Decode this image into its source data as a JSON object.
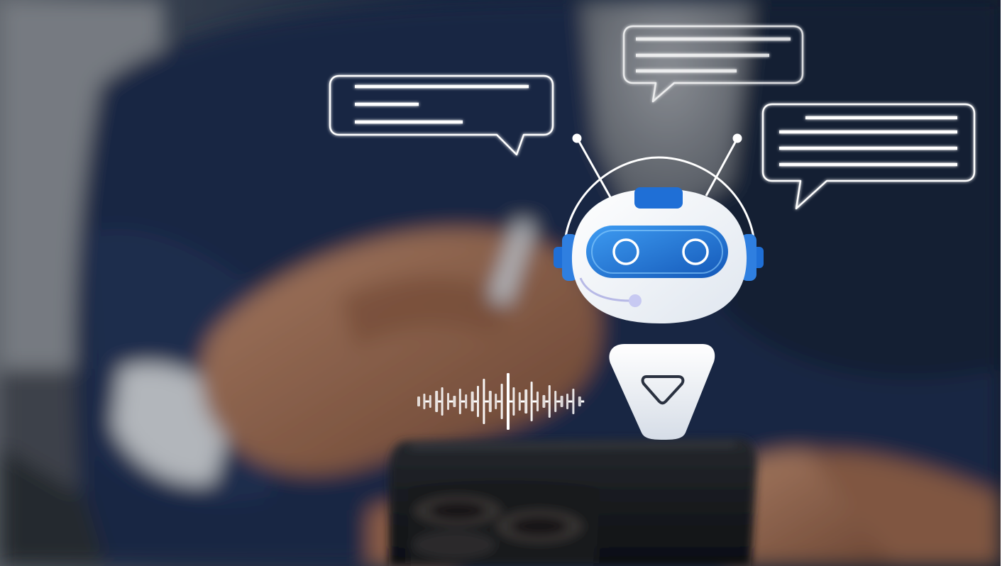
{
  "image": {
    "kind": "photo-illustration",
    "subject": "robot-chatbot-icon",
    "icons": [
      "speech-bubble-icon",
      "robot-icon",
      "headset-icon",
      "sound-wave-icon",
      "play-triangle-icon",
      "smartphone"
    ]
  },
  "colors": {
    "suit": "#1c2b4a",
    "shirt": "#8a8e96",
    "skin": "#b27a5a",
    "phone": "#1a1a1c",
    "robot_white": "#f7f9fc",
    "robot_blue": "#1f6fd6",
    "robot_visor": "#2a8be6",
    "outline": "#ffffff"
  }
}
